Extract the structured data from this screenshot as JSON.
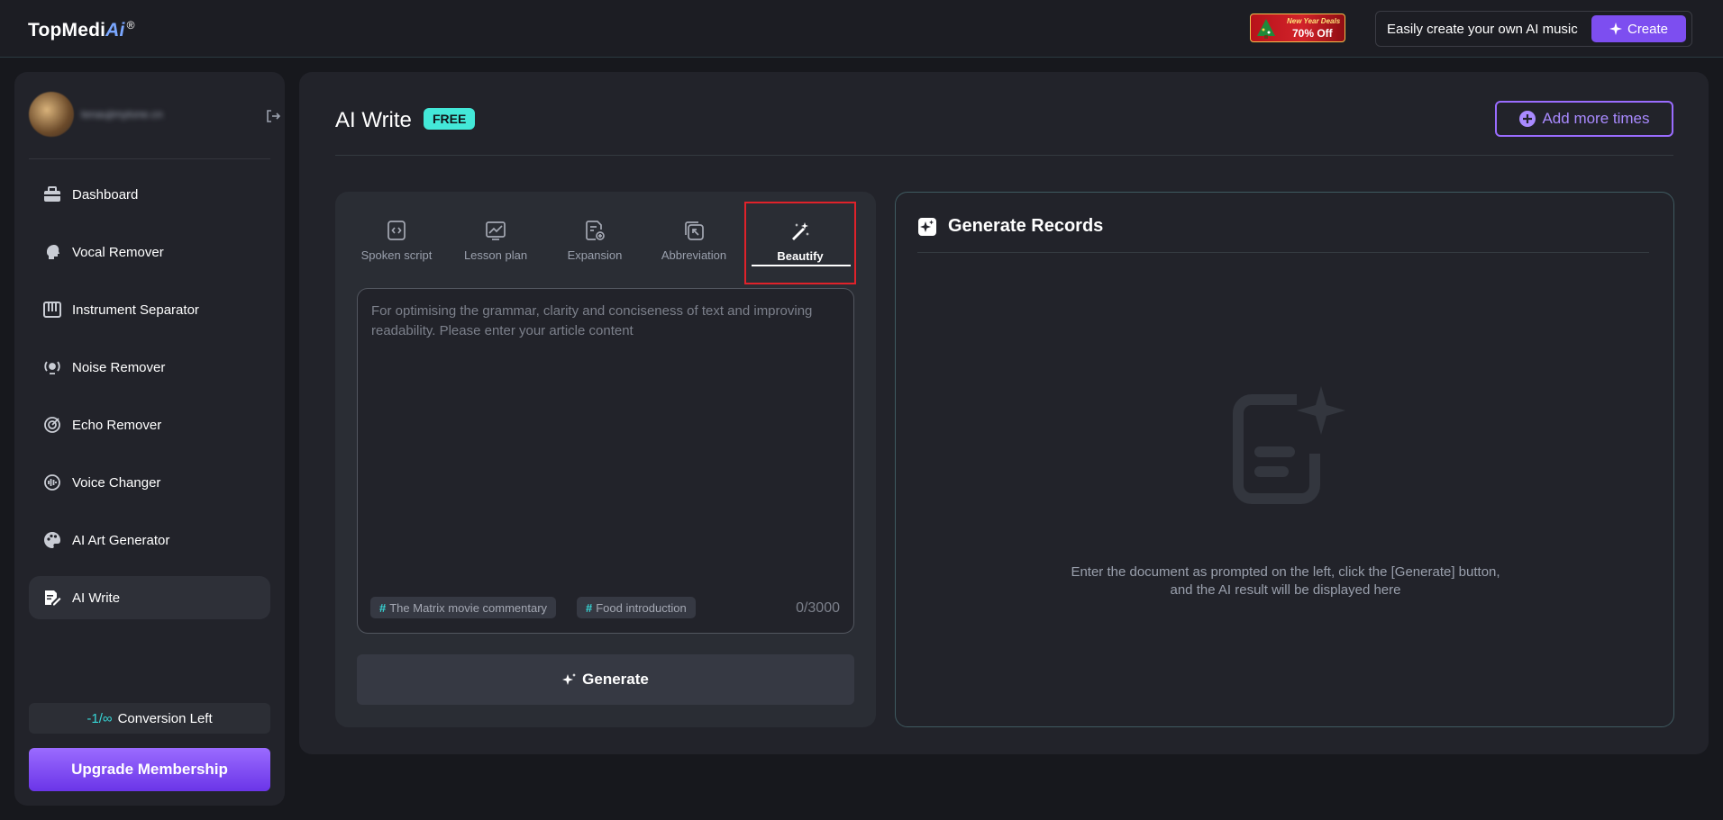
{
  "header": {
    "logo_text": "TopMedi",
    "logo_ai": "Ai",
    "logo_reg": "®",
    "promo_line1": "New Year Deals",
    "promo_line2": "70% Off",
    "music_prompt": "Easily create your own AI music",
    "create_label": "Create"
  },
  "sidebar": {
    "email": "tenaujimytone.cn",
    "items": [
      {
        "label": "Dashboard",
        "icon": "briefcase-icon"
      },
      {
        "label": "Vocal Remover",
        "icon": "head-icon"
      },
      {
        "label": "Instrument Separator",
        "icon": "piano-icon"
      },
      {
        "label": "Noise Remover",
        "icon": "noise-icon"
      },
      {
        "label": "Echo Remover",
        "icon": "echo-icon"
      },
      {
        "label": "Voice Changer",
        "icon": "voice-icon"
      },
      {
        "label": "AI Art Generator",
        "icon": "palette-icon"
      },
      {
        "label": "AI Write",
        "icon": "write-icon",
        "active": true
      }
    ],
    "conversion_count": "-1/∞",
    "conversion_label": "Conversion Left",
    "upgrade_label": "Upgrade Membership"
  },
  "main": {
    "title": "AI Write",
    "badge": "FREE",
    "add_more_label": "Add more times",
    "tabs": [
      {
        "label": "Spoken script",
        "icon": "code-doc-icon"
      },
      {
        "label": "Lesson plan",
        "icon": "chart-icon"
      },
      {
        "label": "Expansion",
        "icon": "doc-plus-icon"
      },
      {
        "label": "Abbreviation",
        "icon": "shrink-icon"
      },
      {
        "label": "Beautify",
        "icon": "magic-wand-icon",
        "active": true
      }
    ],
    "editor": {
      "placeholder": "For optimising the grammar, clarity and conciseness of text and improving readability. Please enter your article content",
      "value": "",
      "chips": [
        "The Matrix movie commentary",
        "Food introduction"
      ],
      "counter": "0/3000"
    },
    "generate_label": "Generate",
    "records": {
      "title": "Generate Records",
      "empty_line1": "Enter the document as prompted on the left, click the [Generate] button,",
      "empty_line2": "and the AI result will be displayed here"
    }
  },
  "colors": {
    "accent_purple": "#7d4ef0",
    "accent_teal": "#43e8d8",
    "highlight_red": "#e0222a"
  }
}
